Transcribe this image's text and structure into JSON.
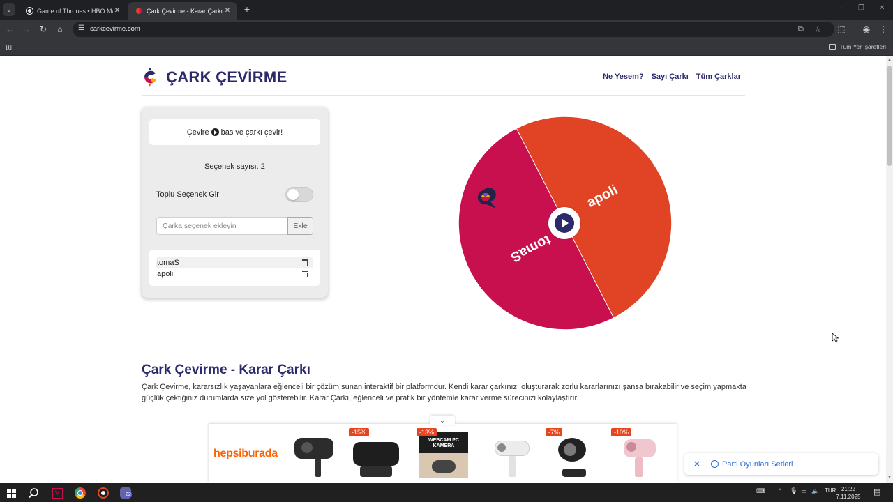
{
  "browser": {
    "tabs": [
      {
        "title": "Game of Thrones • HBO Max",
        "active": false
      },
      {
        "title": "Çark Çevirme - Karar Çarkı",
        "active": true
      }
    ],
    "url": "carkcevirme.com",
    "bookmarks_all_label": "Tüm Yer İşaretleri"
  },
  "site": {
    "brand": "ÇARK ÇEVİRME",
    "nav": [
      "Ne Yesem?",
      "Sayı Çarkı",
      "Tüm Çarklar"
    ]
  },
  "panel": {
    "hint_before": "Çevire",
    "hint_after": "bas ve çarkı çevir!",
    "count_label": "Seçenek sayısı: 2",
    "bulk_label": "Toplu Seçenek Gir",
    "bulk_enabled": false,
    "input_placeholder": "Çarka seçenek ekleyin",
    "add_label": "Ekle",
    "options": [
      "tomaS",
      "apoli"
    ]
  },
  "wheel": {
    "segments": [
      {
        "label": "tomaS",
        "color": "#c8104f"
      },
      {
        "label": "apoli",
        "color": "#e04424"
      }
    ],
    "accent": "#2b2a6b"
  },
  "content": {
    "title": "Çark Çevirme - Karar Çarkı",
    "text": "Çark Çevirme, kararsızlık yaşayanlara eğlenceli bir çözüm sunan interaktif bir platformdur. Kendi karar çarkınızı oluşturarak zorlu kararlarınızı şansa bırakabilir ve seçim yapmakta güçlük çektiğiniz durumlarda size yol gösterebilir. Karar Çarkı, eğlenceli ve pratik bir yöntemle karar verme sürecinizi kolaylaştırır."
  },
  "ad": {
    "brand": "hepsiburada",
    "discounts": [
      "-15%",
      "-13%",
      "-7%",
      "-10%"
    ],
    "webcam_caption": "WEBCAM PC KAMERA"
  },
  "party_bar": {
    "label": "Parti Oyunları Setleri"
  },
  "taskbar": {
    "language": "TUR",
    "time": "21:22",
    "date": "7.11.2025",
    "badge": "22"
  }
}
